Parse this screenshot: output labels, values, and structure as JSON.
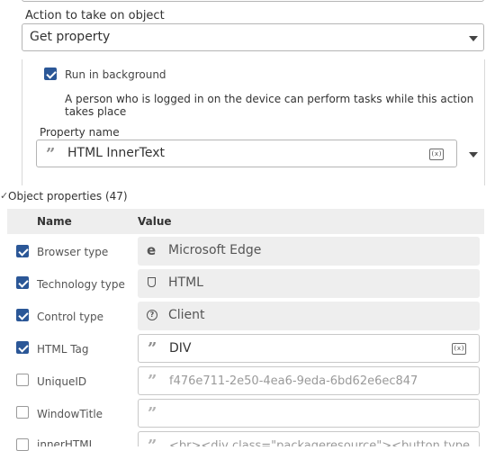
{
  "action": {
    "label": "Action to take on object",
    "value": "Get property"
  },
  "run_in_background": {
    "label": "Run in background",
    "checked": true,
    "description": "A person who is logged in on the device can perform tasks while this action takes place"
  },
  "property_name": {
    "label": "Property name",
    "value": "HTML InnerText",
    "variable_icon": "(x)"
  },
  "object_properties": {
    "title": "Object properties (47)",
    "columns": {
      "name": "Name",
      "value": "Value"
    },
    "rows": [
      {
        "name": "Browser type",
        "checked": true,
        "value": "Microsoft Edge",
        "icon": "edge-icon",
        "editable": false
      },
      {
        "name": "Technology type",
        "checked": true,
        "value": "HTML",
        "icon": "html5-icon",
        "editable": false
      },
      {
        "name": "Control type",
        "checked": true,
        "value": "Client",
        "icon": "help-circle-icon",
        "editable": false
      },
      {
        "name": "HTML Tag",
        "checked": true,
        "value": "DIV",
        "icon": "quote-icon",
        "editable": true
      },
      {
        "name": "UniqueID",
        "checked": false,
        "value": "f476e711-2e50-4ea6-9eda-6bd62e6ec847",
        "icon": "quote-icon",
        "editable": true
      },
      {
        "name": "WindowTitle",
        "checked": false,
        "value": "",
        "icon": "quote-icon",
        "editable": true
      },
      {
        "name": "innerHTML",
        "checked": false,
        "value": "<br><div class=\"packageresource\"><button type=\"",
        "icon": "quote-icon",
        "editable": true
      }
    ]
  },
  "colors": {
    "accent": "#2b5797",
    "readonly_bg": "#eeeeee",
    "border": "#b5b5b5"
  }
}
